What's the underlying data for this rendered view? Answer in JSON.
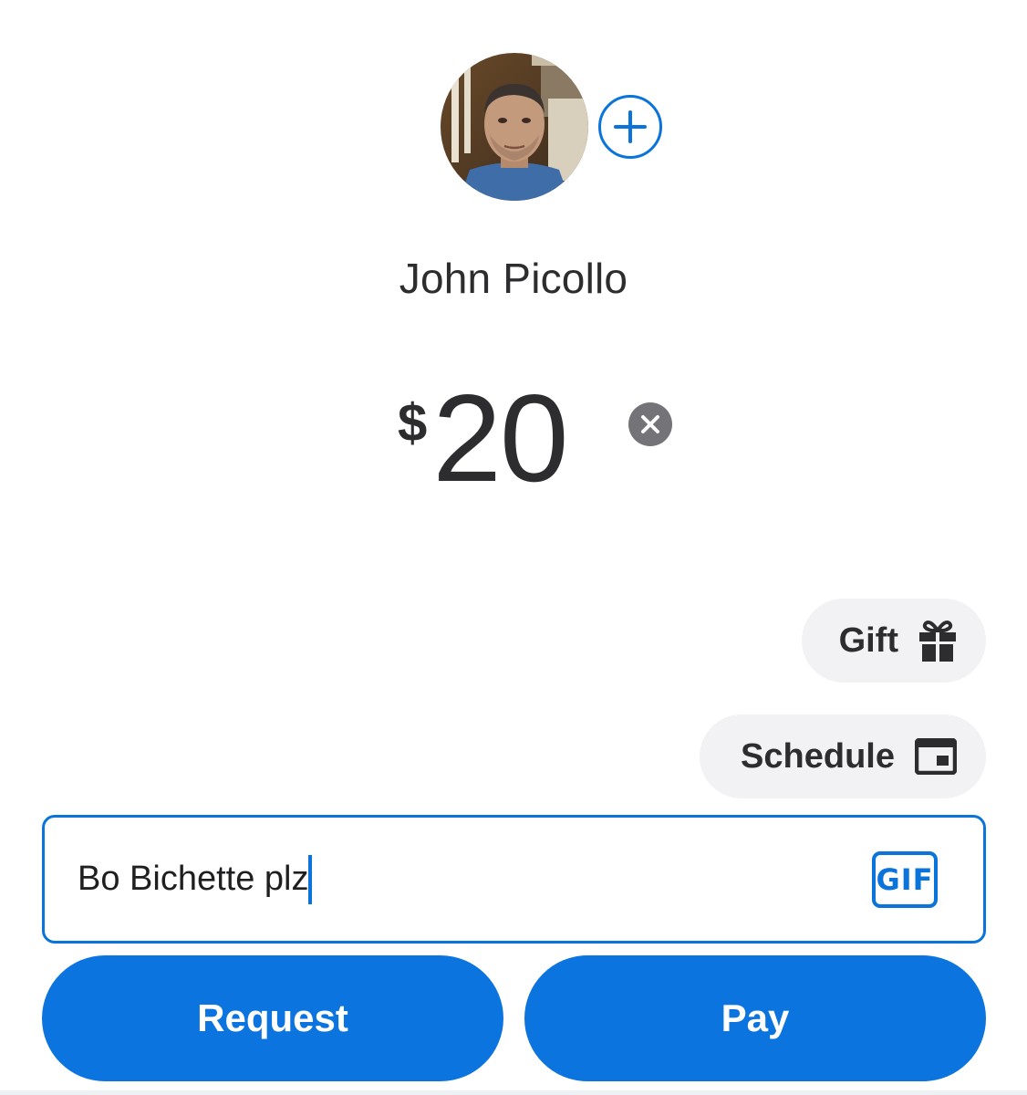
{
  "recipient": {
    "name": "John Picollo",
    "avatar": "profile-photo",
    "add_icon": "plus-circle-icon"
  },
  "payment": {
    "currency_symbol": "$",
    "amount": "20",
    "clear_icon": "clear-x-icon"
  },
  "options": {
    "gift_label": "Gift",
    "gift_icon": "gift-icon",
    "schedule_label": "Schedule",
    "schedule_icon": "calendar-icon"
  },
  "note": {
    "value": "Bo Bichette plz",
    "gif_label": "GIF"
  },
  "actions": {
    "request_label": "Request",
    "pay_label": "Pay"
  },
  "colors": {
    "accent": "#0B74DE",
    "chip_bg": "#F2F2F4",
    "text": "#2D2D2F",
    "clear_button": "#737378"
  }
}
